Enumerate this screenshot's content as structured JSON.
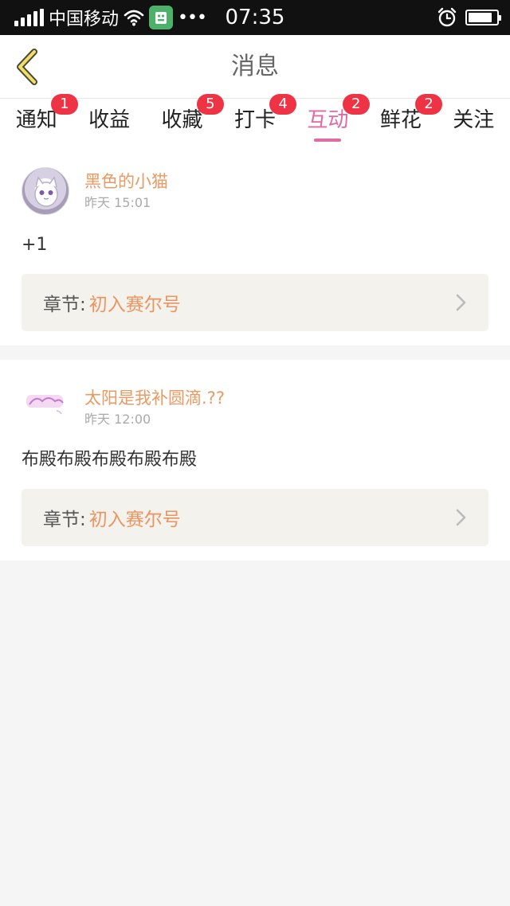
{
  "status_bar": {
    "carrier": "中国移动",
    "time": "07:35",
    "dots": "•••",
    "battery_level": 0.85
  },
  "nav": {
    "title": "消息"
  },
  "tabs": [
    {
      "label": "通知",
      "badge": "1",
      "active": false
    },
    {
      "label": "收益",
      "badge": "",
      "active": false
    },
    {
      "label": "收藏",
      "badge": "5",
      "active": false
    },
    {
      "label": "打卡",
      "badge": "4",
      "active": false
    },
    {
      "label": "互动",
      "badge": "2",
      "active": true
    },
    {
      "label": "鲜花",
      "badge": "2",
      "active": false
    },
    {
      "label": "关注",
      "badge": "",
      "active": false
    }
  ],
  "messages": [
    {
      "user": "黑色的小猫",
      "time": "昨天 15:01",
      "body": "+1",
      "chapter_label": "章节:",
      "chapter_name": "初入赛尔号"
    },
    {
      "user": "太阳是我补圆滴.??",
      "time": "昨天 12:00",
      "body": "布殿布殿布殿布殿布殿",
      "chapter_label": "章节:",
      "chapter_name": "初入赛尔号"
    }
  ],
  "colors": {
    "accent": "#e26aa3",
    "username": "#e99a62",
    "badge": "#ee3344",
    "chapter_bg": "#f3f2ec"
  }
}
